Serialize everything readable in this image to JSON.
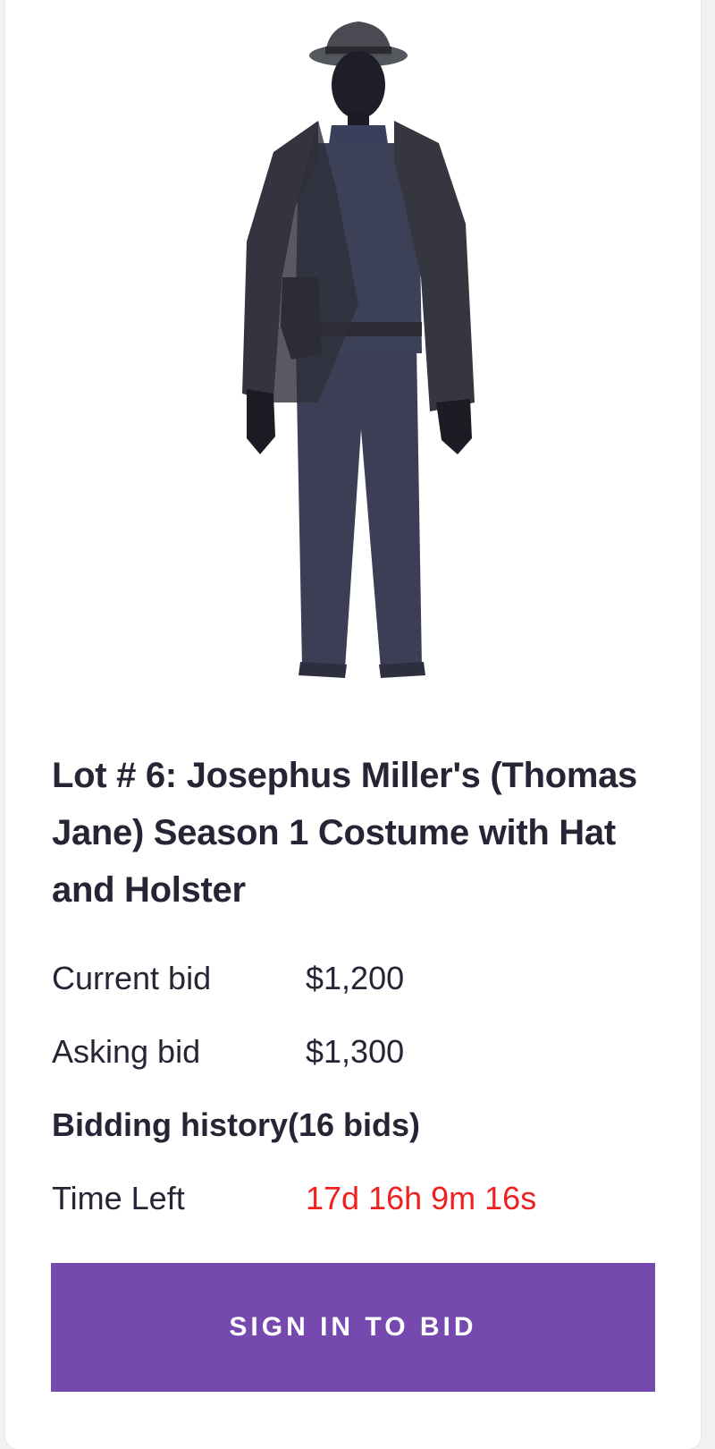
{
  "lot": {
    "title": "Lot # 6: Josephus Miller's (Thomas Jane) Season 1 Costume with Hat and Holster",
    "image_subject": "mannequin-costume-with-hat-and-holster"
  },
  "bids": {
    "current_label": "Current bid",
    "current_value": "$1,200",
    "asking_label": "Asking bid",
    "asking_value": "$1,300",
    "history_label": "Bidding history(16 bids)",
    "time_left_label": "Time Left",
    "time_left_value": "17d 16h 9m 16s"
  },
  "action": {
    "sign_in_label": "SIGN IN TO BID"
  },
  "colors": {
    "accent": "#7549ae",
    "time_left": "#ef2020",
    "text": "#252536",
    "costume": "#3a3d52"
  }
}
